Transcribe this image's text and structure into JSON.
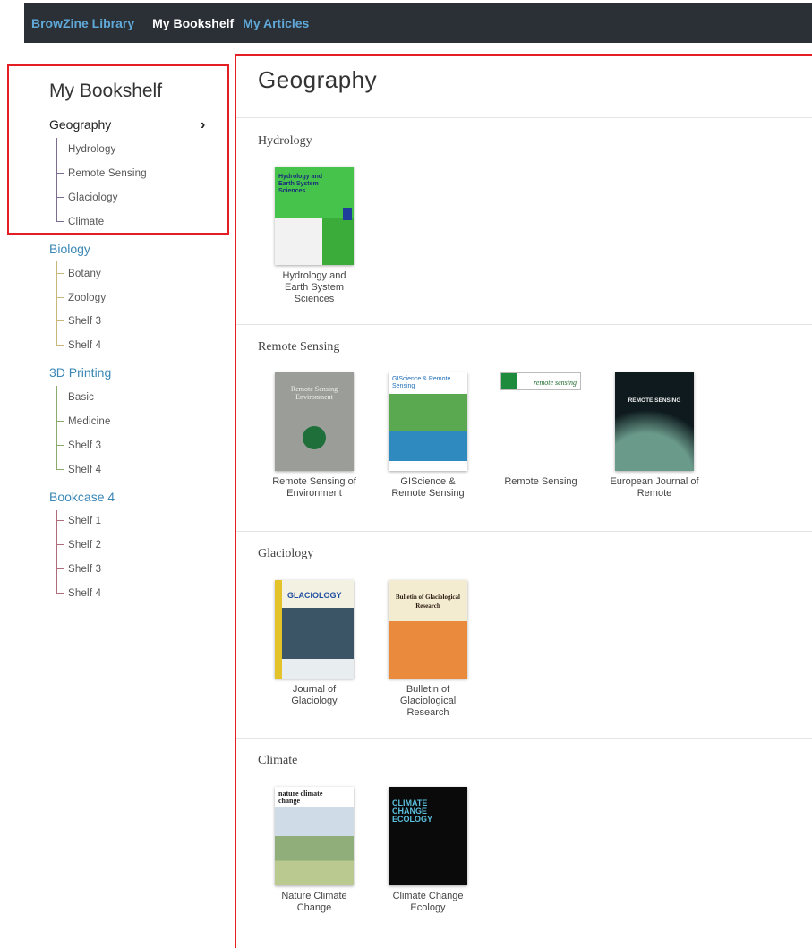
{
  "nav": {
    "library": "BrowZine Library",
    "bookshelf": "My Bookshelf",
    "articles": "My Articles"
  },
  "sidebar": {
    "title": "My Bookshelf",
    "bookcases": [
      {
        "label": "Geography",
        "color": "#7b6d8d",
        "shelves": [
          "Hydrology",
          "Remote Sensing",
          "Glaciology",
          "Climate"
        ]
      },
      {
        "label": "Biology",
        "color": "#c8b878",
        "shelves": [
          "Botany",
          "Zoology",
          "Shelf 3",
          "Shelf 4"
        ]
      },
      {
        "label": "3D Printing",
        "color": "#8cab6a",
        "shelves": [
          "Basic",
          "Medicine",
          "Shelf 3",
          "Shelf 4"
        ]
      },
      {
        "label": "Bookcase 4",
        "color": "#b06d7e",
        "shelves": [
          "Shelf 1",
          "Shelf 2",
          "Shelf 3",
          "Shelf 4"
        ]
      }
    ]
  },
  "main": {
    "title": "Geography",
    "sections": [
      {
        "title": "Hydrology",
        "journals": [
          {
            "name": "Hydrology and Earth System Sciences",
            "cover_text": "Hydrology and Earth System Sciences"
          }
        ]
      },
      {
        "title": "Remote Sensing",
        "journals": [
          {
            "name": "Remote Sensing of Environment",
            "cover_text": "Remote Sensing Environment"
          },
          {
            "name": "GIScience & Remote Sensing",
            "cover_text": "GIScience & Remote Sensing"
          },
          {
            "name": "Remote Sensing",
            "cover_text": "remote sensing"
          },
          {
            "name": "European Journal of Remote",
            "cover_text": "REMOTE SENSING"
          }
        ]
      },
      {
        "title": "Glaciology",
        "journals": [
          {
            "name": "Journal of Glaciology",
            "cover_text": "GLACIOLOGY"
          },
          {
            "name": "Bulletin of Glaciological Research",
            "cover_text": "Bulletin of Glaciological Research"
          }
        ]
      },
      {
        "title": "Climate",
        "journals": [
          {
            "name": "Nature Climate Change",
            "cover_text": "nature climate change"
          },
          {
            "name": "Climate Change Ecology",
            "cover_text": "CLIMATE CHANGE ECOLOGY"
          }
        ]
      }
    ]
  }
}
